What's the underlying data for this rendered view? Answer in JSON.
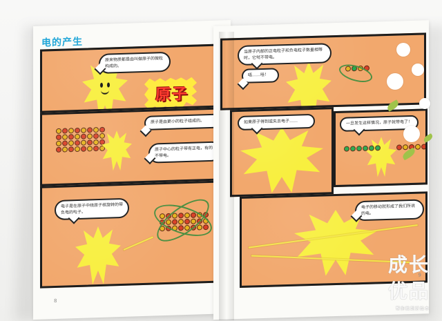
{
  "book": {
    "left_title": "电的产生",
    "page_left_number": "8",
    "page_right_number": "9"
  },
  "left_panels": {
    "p1": {
      "bubble": "原来物质都是由叫做原子的微粒构成的。",
      "atom_label": "原子"
    },
    "p2": {
      "bubble1": "原子是由更小的粒子组成的。",
      "bubble2": "原子中心的粒子带有正电，有的不带电。"
    },
    "p3": {
      "bubble": "电子是在原子中绕原子核旋转的带负电的粒子。"
    }
  },
  "right_panels": {
    "p1": {
      "bubble1": "当原子内部的正电粒子和负电粒子数量相等时，它就不带电。",
      "bubble2": "唔……哇！"
    },
    "p2": {
      "bubble": "如果原子得到或失去电子……"
    },
    "p3": {
      "bubble": "一旦发生这样情况，原子就带电了！"
    },
    "p4": {
      "bubble": "电子的移动就形成了我们所说的电。"
    }
  },
  "watermark": {
    "line1": "成长",
    "line2": "优品",
    "line3": "帮你找到好绘本"
  }
}
